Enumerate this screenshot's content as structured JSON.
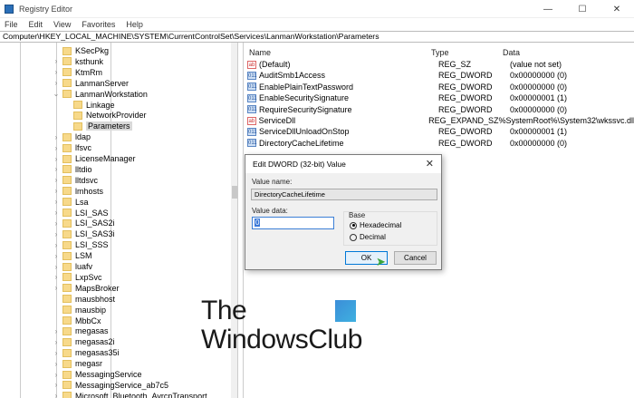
{
  "window": {
    "title": "Registry Editor",
    "minimize": "—",
    "maximize": "☐",
    "close": "✕"
  },
  "menu": [
    "File",
    "Edit",
    "View",
    "Favorites",
    "Help"
  ],
  "address": "Computer\\HKEY_LOCAL_MACHINE\\SYSTEM\\CurrentControlSet\\Services\\LanmanWorkstation\\Parameters",
  "tree": [
    {
      "label": "KSecPkg",
      "level": 0,
      "exp": ""
    },
    {
      "label": "ksthunk",
      "level": 0,
      "exp": ">"
    },
    {
      "label": "KtmRm",
      "level": 0,
      "exp": ">"
    },
    {
      "label": "LanmanServer",
      "level": 0,
      "exp": ">"
    },
    {
      "label": "LanmanWorkstation",
      "level": 0,
      "exp": "v"
    },
    {
      "label": "Linkage",
      "level": 1,
      "exp": ""
    },
    {
      "label": "NetworkProvider",
      "level": 1,
      "exp": ""
    },
    {
      "label": "Parameters",
      "level": 1,
      "exp": "",
      "selected": true
    },
    {
      "label": "ldap",
      "level": 0,
      "exp": ">"
    },
    {
      "label": "lfsvc",
      "level": 0,
      "exp": ">"
    },
    {
      "label": "LicenseManager",
      "level": 0,
      "exp": ">"
    },
    {
      "label": "lltdio",
      "level": 0,
      "exp": ">"
    },
    {
      "label": "lltdsvc",
      "level": 0,
      "exp": ">"
    },
    {
      "label": "lmhosts",
      "level": 0,
      "exp": ">"
    },
    {
      "label": "Lsa",
      "level": 0,
      "exp": ">"
    },
    {
      "label": "LSI_SAS",
      "level": 0,
      "exp": ">"
    },
    {
      "label": "LSI_SAS2i",
      "level": 0,
      "exp": ">"
    },
    {
      "label": "LSI_SAS3i",
      "level": 0,
      "exp": ">"
    },
    {
      "label": "LSI_SSS",
      "level": 0,
      "exp": ">"
    },
    {
      "label": "LSM",
      "level": 0,
      "exp": ">"
    },
    {
      "label": "luafv",
      "level": 0,
      "exp": ">"
    },
    {
      "label": "LxpSvc",
      "level": 0,
      "exp": ">"
    },
    {
      "label": "MapsBroker",
      "level": 0,
      "exp": ">"
    },
    {
      "label": "mausbhost",
      "level": 0,
      "exp": ""
    },
    {
      "label": "mausbip",
      "level": 0,
      "exp": ""
    },
    {
      "label": "MbbCx",
      "level": 0,
      "exp": ""
    },
    {
      "label": "megasas",
      "level": 0,
      "exp": ">"
    },
    {
      "label": "megasas2i",
      "level": 0,
      "exp": ">"
    },
    {
      "label": "megasas35i",
      "level": 0,
      "exp": ">"
    },
    {
      "label": "megasr",
      "level": 0,
      "exp": ">"
    },
    {
      "label": "MessagingService",
      "level": 0,
      "exp": ">"
    },
    {
      "label": "MessagingService_ab7c5",
      "level": 0,
      "exp": ">"
    },
    {
      "label": "Microsoft_Bluetooth_AvrcpTransport",
      "level": 0,
      "exp": ">"
    }
  ],
  "columns": {
    "name": "Name",
    "type": "Type",
    "data": "Data"
  },
  "values": [
    {
      "name": "(Default)",
      "type": "REG_SZ",
      "data": "(value not set)",
      "icon": "sz"
    },
    {
      "name": "AuditSmb1Access",
      "type": "REG_DWORD",
      "data": "0x00000000 (0)",
      "icon": "dw"
    },
    {
      "name": "EnablePlainTextPassword",
      "type": "REG_DWORD",
      "data": "0x00000000 (0)",
      "icon": "dw"
    },
    {
      "name": "EnableSecuritySignature",
      "type": "REG_DWORD",
      "data": "0x00000001 (1)",
      "icon": "dw"
    },
    {
      "name": "RequireSecuritySignature",
      "type": "REG_DWORD",
      "data": "0x00000000 (0)",
      "icon": "dw"
    },
    {
      "name": "ServiceDll",
      "type": "REG_EXPAND_SZ",
      "data": "%SystemRoot%\\System32\\wkssvc.dll",
      "icon": "sz"
    },
    {
      "name": "ServiceDllUnloadOnStop",
      "type": "REG_DWORD",
      "data": "0x00000001 (1)",
      "icon": "dw"
    },
    {
      "name": "DirectoryCacheLifetime",
      "type": "REG_DWORD",
      "data": "0x00000000 (0)",
      "icon": "dw"
    }
  ],
  "dialog": {
    "title": "Edit DWORD (32-bit) Value",
    "close": "✕",
    "value_name_label": "Value name:",
    "value_name": "DirectoryCacheLifetime",
    "value_data_label": "Value data:",
    "value_data": "0",
    "base_label": "Base",
    "hex": "Hexadecimal",
    "dec": "Decimal",
    "base_selected": "Hexadecimal",
    "ok": "OK",
    "cancel": "Cancel"
  },
  "watermark": {
    "line1": "The",
    "line2": "WindowsClub"
  }
}
